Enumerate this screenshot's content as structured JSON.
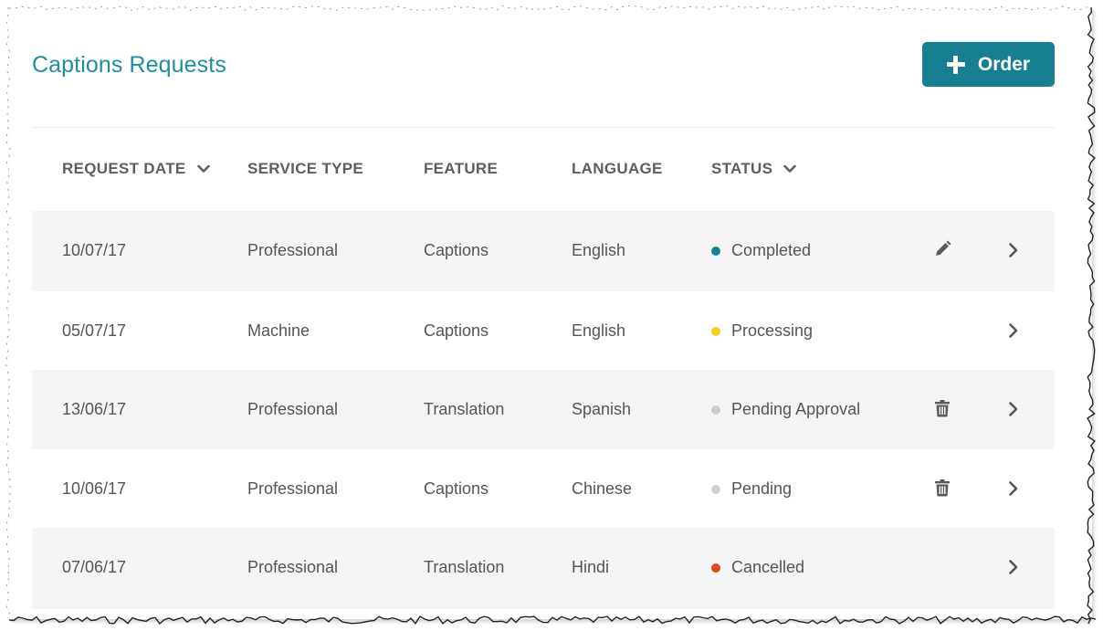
{
  "page": {
    "title": "Captions Requests",
    "order_button": {
      "label": "Order",
      "icon": "plus-icon"
    }
  },
  "table": {
    "columns": [
      {
        "key": "request_date",
        "label": "REQUEST DATE",
        "sortable": true,
        "sort_icon": "chevron-down-icon"
      },
      {
        "key": "service_type",
        "label": "SERVICE TYPE",
        "sortable": false
      },
      {
        "key": "feature",
        "label": "FEATURE",
        "sortable": false
      },
      {
        "key": "language",
        "label": "LANGUAGE",
        "sortable": false
      },
      {
        "key": "status",
        "label": "STATUS",
        "sortable": true,
        "sort_icon": "chevron-down-icon"
      }
    ],
    "rows": [
      {
        "request_date": "10/07/17",
        "service_type": "Professional",
        "feature": "Captions",
        "language": "English",
        "status": "Completed",
        "status_color": "#177f91",
        "action": "pencil-icon"
      },
      {
        "request_date": "05/07/17",
        "service_type": "Machine",
        "feature": "Captions",
        "language": "English",
        "status": "Processing",
        "status_color": "#f5d21b",
        "action": ""
      },
      {
        "request_date": "13/06/17",
        "service_type": "Professional",
        "feature": "Translation",
        "language": "Spanish",
        "status": "Pending Approval",
        "status_color": "#cfcfcf",
        "action": "trash-icon"
      },
      {
        "request_date": "10/06/17",
        "service_type": "Professional",
        "feature": "Captions",
        "language": "Chinese",
        "status": "Pending",
        "status_color": "#cfcfcf",
        "action": "trash-icon"
      },
      {
        "request_date": "07/06/17",
        "service_type": "Professional",
        "feature": "Translation",
        "language": "Hindi",
        "status": "Cancelled",
        "status_color": "#e0441c",
        "action": ""
      }
    ]
  },
  "colors": {
    "accent": "#177f91",
    "title": "#1e8fa0",
    "row_shade": "#f5f5f5"
  }
}
